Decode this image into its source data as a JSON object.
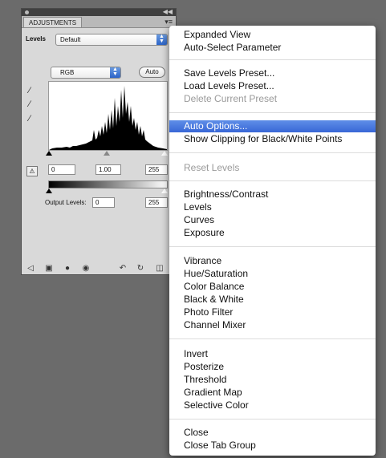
{
  "panel": {
    "tab_label": "ADJUSTMENTS",
    "preset_label": "Levels",
    "preset_value": "Default",
    "channel_value": "RGB",
    "auto_button": "Auto",
    "input_black": "0",
    "input_gamma": "1.00",
    "input_white": "255",
    "output_label": "Output Levels:",
    "output_black": "0",
    "output_white": "255"
  },
  "menu": {
    "items": [
      {
        "label": "Expanded View"
      },
      {
        "label": "Auto-Select Parameter"
      },
      {
        "label": "Save Levels Preset..."
      },
      {
        "label": "Load Levels Preset..."
      },
      {
        "label": "Delete Current Preset",
        "disabled": true
      },
      {
        "label": "Auto Options...",
        "highlighted": true
      },
      {
        "label": "Show Clipping for Black/White Points"
      },
      {
        "label": "Reset Levels",
        "disabled": true
      },
      {
        "label": "Brightness/Contrast"
      },
      {
        "label": "Levels"
      },
      {
        "label": "Curves"
      },
      {
        "label": "Exposure"
      },
      {
        "label": "Vibrance"
      },
      {
        "label": "Hue/Saturation"
      },
      {
        "label": "Color Balance"
      },
      {
        "label": "Black & White"
      },
      {
        "label": "Photo Filter"
      },
      {
        "label": "Channel Mixer"
      },
      {
        "label": "Invert"
      },
      {
        "label": "Posterize"
      },
      {
        "label": "Threshold"
      },
      {
        "label": "Gradient Map"
      },
      {
        "label": "Selective Color"
      },
      {
        "label": "Close"
      },
      {
        "label": "Close Tab Group"
      }
    ]
  },
  "colors": {
    "highlight": "#3f6fdb",
    "background": "#6b6b6b"
  }
}
